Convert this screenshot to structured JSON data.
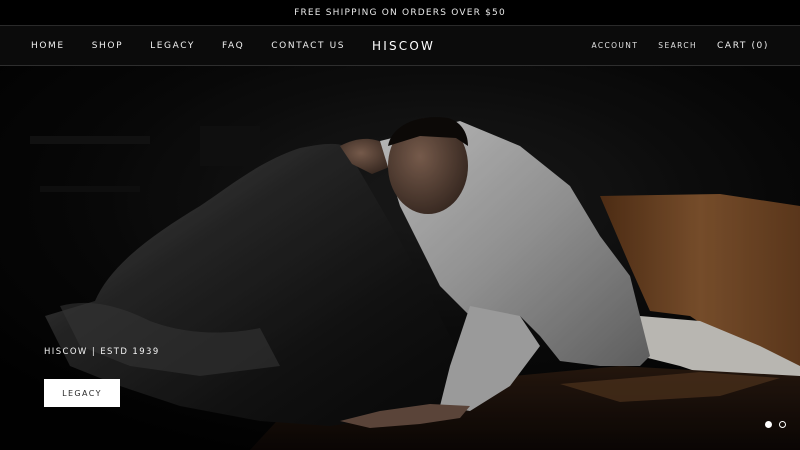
{
  "announcement": {
    "text": "FREE SHIPPING ON ORDERS OVER $50"
  },
  "header": {
    "nav_left": [
      {
        "label": "HOME"
      },
      {
        "label": "SHOP"
      },
      {
        "label": "LEGACY"
      },
      {
        "label": "FAQ"
      },
      {
        "label": "CONTACT US"
      }
    ],
    "logo": "HISCOW",
    "account_label": "ACCOUNT",
    "search_label": "SEARCH",
    "cart_label": "CART (0)"
  },
  "hero": {
    "subtitle": "HISCOW | ESTD 1939",
    "button_label": "LEGACY",
    "slides": [
      {
        "state": "active"
      },
      {
        "state": "inactive"
      }
    ]
  },
  "colors": {
    "background": "#000000",
    "header_background": "#0b0b0b",
    "text": "#ffffff",
    "button_background": "#ffffff",
    "button_text": "#2a2a2a"
  }
}
